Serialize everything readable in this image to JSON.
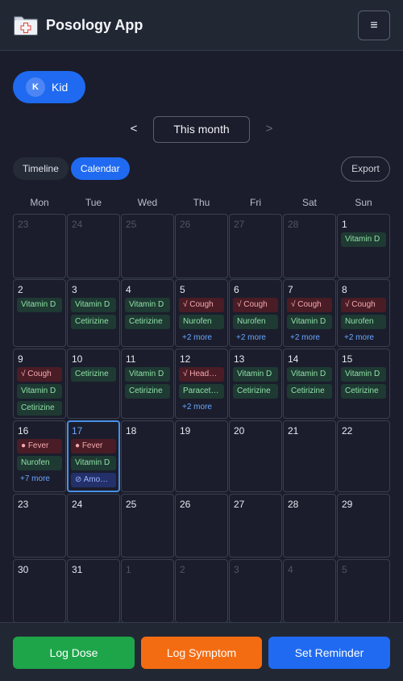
{
  "app": {
    "title": "Posology App",
    "menu_glyph": "≡",
    "logo_icon": "medical-case-icon"
  },
  "profile": {
    "initial": "K",
    "name": "Kid"
  },
  "month_nav": {
    "prev": "<",
    "label": "This month",
    "next": ">"
  },
  "view_tabs": {
    "timeline": "Timeline",
    "calendar": "Calendar",
    "active": "Calendar"
  },
  "export_label": "Export",
  "weekdays": [
    "Mon",
    "Tue",
    "Wed",
    "Thu",
    "Fri",
    "Sat",
    "Sun"
  ],
  "colors": {
    "accent": "#1f6af0",
    "dose": "#1ea54a",
    "symptom": "#f46c12",
    "today_border": "#4a90e6",
    "med_pill": "#1e3a33",
    "symptom_pill": "#4a1c25",
    "reminder_pill": "#23306a"
  },
  "weeks": [
    [
      {
        "day": "23",
        "out": true
      },
      {
        "day": "24",
        "out": true
      },
      {
        "day": "25",
        "out": true
      },
      {
        "day": "26",
        "out": true
      },
      {
        "day": "27",
        "out": true
      },
      {
        "day": "28",
        "out": true
      },
      {
        "day": "1",
        "events": [
          {
            "type": "med",
            "label": "Vitamin D"
          }
        ]
      }
    ],
    [
      {
        "day": "2",
        "events": [
          {
            "type": "med",
            "label": "Vitamin D"
          }
        ]
      },
      {
        "day": "3",
        "events": [
          {
            "type": "med",
            "label": "Vitamin D"
          },
          {
            "type": "med",
            "label": "Cetirizine"
          }
        ]
      },
      {
        "day": "4",
        "events": [
          {
            "type": "med",
            "label": "Vitamin D"
          },
          {
            "type": "med",
            "label": "Cetirizine"
          }
        ]
      },
      {
        "day": "5",
        "events": [
          {
            "type": "sym",
            "label": "√ Cough"
          },
          {
            "type": "med",
            "label": "Nurofen"
          }
        ],
        "more": "+2 more"
      },
      {
        "day": "6",
        "events": [
          {
            "type": "sym",
            "label": "√ Cough"
          },
          {
            "type": "med",
            "label": "Nurofen"
          }
        ],
        "more": "+2 more"
      },
      {
        "day": "7",
        "events": [
          {
            "type": "sym",
            "label": "√ Cough"
          },
          {
            "type": "med",
            "label": "Vitamin D"
          }
        ],
        "more": "+2 more"
      },
      {
        "day": "8",
        "events": [
          {
            "type": "sym",
            "label": "√ Cough"
          },
          {
            "type": "med",
            "label": "Nurofen"
          }
        ],
        "more": "+2 more"
      }
    ],
    [
      {
        "day": "9",
        "events": [
          {
            "type": "sym",
            "label": "√ Cough"
          },
          {
            "type": "med",
            "label": "Vitamin D"
          },
          {
            "type": "med",
            "label": "Cetirizine"
          }
        ]
      },
      {
        "day": "10",
        "events": [
          {
            "type": "med",
            "label": "Cetirizine"
          }
        ]
      },
      {
        "day": "11",
        "events": [
          {
            "type": "med",
            "label": "Vitamin D"
          },
          {
            "type": "med",
            "label": "Cetirizine"
          }
        ]
      },
      {
        "day": "12",
        "events": [
          {
            "type": "sym",
            "label": "√ Headache"
          },
          {
            "type": "med",
            "label": "Paracetamol"
          }
        ],
        "more": "+2 more"
      },
      {
        "day": "13",
        "events": [
          {
            "type": "med",
            "label": "Vitamin D"
          },
          {
            "type": "med",
            "label": "Cetirizine"
          }
        ]
      },
      {
        "day": "14",
        "events": [
          {
            "type": "med",
            "label": "Vitamin D"
          },
          {
            "type": "med",
            "label": "Cetirizine"
          }
        ]
      },
      {
        "day": "15",
        "events": [
          {
            "type": "med",
            "label": "Vitamin D"
          },
          {
            "type": "med",
            "label": "Cetirizine"
          }
        ]
      }
    ],
    [
      {
        "day": "16",
        "events": [
          {
            "type": "sym",
            "label": "● Fever"
          },
          {
            "type": "med",
            "label": "Nurofen"
          }
        ],
        "more": "+7 more"
      },
      {
        "day": "17",
        "today": true,
        "events": [
          {
            "type": "sym",
            "label": "● Fever"
          },
          {
            "type": "med",
            "label": "Vitamin D"
          },
          {
            "type": "rem",
            "label": "⊘ Amoxicillin"
          }
        ]
      },
      {
        "day": "18"
      },
      {
        "day": "19"
      },
      {
        "day": "20"
      },
      {
        "day": "21"
      },
      {
        "day": "22"
      }
    ],
    [
      {
        "day": "23"
      },
      {
        "day": "24"
      },
      {
        "day": "25"
      },
      {
        "day": "26"
      },
      {
        "day": "27"
      },
      {
        "day": "28"
      },
      {
        "day": "29"
      }
    ],
    [
      {
        "day": "30"
      },
      {
        "day": "31"
      },
      {
        "day": "1",
        "out": true
      },
      {
        "day": "2",
        "out": true
      },
      {
        "day": "3",
        "out": true
      },
      {
        "day": "4",
        "out": true
      },
      {
        "day": "5",
        "out": true
      }
    ]
  ],
  "actions": {
    "log_dose": "Log Dose",
    "log_symptom": "Log Symptom",
    "set_reminder": "Set Reminder"
  }
}
